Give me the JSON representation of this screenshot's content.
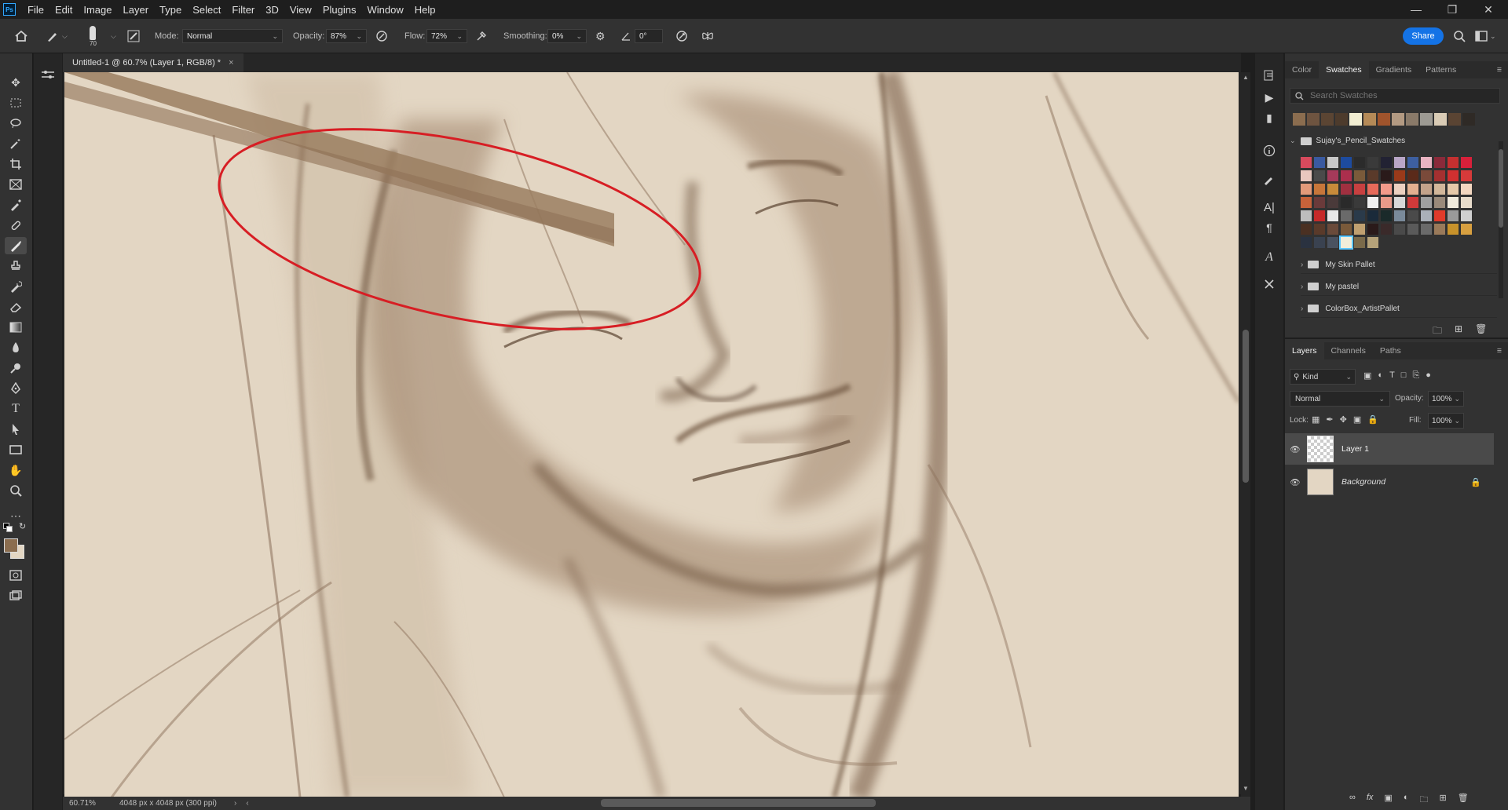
{
  "app": {
    "logo": "Ps",
    "menu": [
      "File",
      "Edit",
      "Image",
      "Layer",
      "Type",
      "Select",
      "Filter",
      "3D",
      "View",
      "Plugins",
      "Window",
      "Help"
    ]
  },
  "options": {
    "brush_size": "70",
    "mode_label": "Mode:",
    "mode_value": "Normal",
    "opacity_label": "Opacity:",
    "opacity_value": "87%",
    "flow_label": "Flow:",
    "flow_value": "72%",
    "smoothing_label": "Smoothing:",
    "smoothing_value": "0%",
    "angle_value": "0°",
    "share_label": "Share"
  },
  "document": {
    "tab_title": "Untitled-1 @ 60.7% (Layer 1, RGB/8) *",
    "zoom": "60.71%",
    "dimensions": "4048 px x 4048 px (300 ppi)"
  },
  "swatches_panel": {
    "tabs": [
      "Color",
      "Swatches",
      "Gradients",
      "Patterns"
    ],
    "active_tab": "Swatches",
    "search_placeholder": "Search Swatches",
    "recent": [
      "#8b6d4f",
      "#6e5440",
      "#5b4533",
      "#4d3b2c",
      "#f2eed2",
      "#b58a57",
      "#a0542c",
      "#b39a82",
      "#8a7a69",
      "#9d9a93",
      "#d9cbb5",
      "#5a4433",
      "#2f2a26"
    ],
    "open_group": "Sujay's_Pencil_Swatches",
    "grid": [
      [
        "#d84a5d",
        "#3a5aa0",
        "#c9c9c9",
        "#1d4b9f",
        "#2b2b2b",
        "#3a3a3a",
        "#222233",
        "#b9a6c7",
        "#3d5fa0",
        "#e9b3c1",
        "#8a2a3a",
        "#c53030",
        "#d8203a"
      ],
      [
        "#e9c8bf",
        "#4a4a4a",
        "#a53a5a",
        "#ab2f4d",
        "#7a5a3a",
        "#5a3a2a",
        "#2a1a1a",
        "#9a3a1a",
        "#5a2a1a",
        "#7a4a3a",
        "#a53030",
        "#d03030",
        "#d63a3a"
      ],
      [
        "#e39a7a",
        "#c7763a",
        "#c78a3a",
        "#a03040",
        "#c84040",
        "#e66a5a",
        "#f29a8a",
        "#ebd0c0",
        "#e3b090",
        "#c2a28a",
        "#d2b79a",
        "#e6c9a9",
        "#f3d7c0"
      ],
      [
        "#c7623a",
        "#6a3a3a",
        "#4a3a3a",
        "#2a2a2a",
        "#3a3a3a",
        "#f0f0f0",
        "#e89a8a",
        "#d8d8d8",
        "#d03a3a",
        "#a0a0a0",
        "#9a8a7a",
        "#f0eadc",
        "#e8dccb"
      ],
      [
        "#bdbdbd",
        "#c62a2a",
        "#e9e9e9",
        "#6a6a6a",
        "#2a3a4a",
        "#1a2a3a",
        "#1a2a2a",
        "#7a8a9a",
        "#4a4a4a",
        "#aab0b9",
        "#e03a2a",
        "#9a9a9a",
        "#d0d0d0"
      ],
      [
        "#4a3022",
        "#5a3a2a",
        "#6a4a3a",
        "#7a5a3a",
        "#c0a070",
        "#2a1a1a",
        "#3a2a2a",
        "#4a4a4a",
        "#5a5a5a",
        "#6a6a6a",
        "#9a7a5a",
        "#c8922a",
        "#d8a040"
      ],
      [
        "#2a3240",
        "#3a4250",
        "#4a5260",
        "#f2eeda",
        "#7a6a4a",
        "#b6a37a"
      ]
    ],
    "folders": [
      "My Skin Pallet",
      "My pastel",
      "ColorBox_ArtistPallet"
    ]
  },
  "layers_panel": {
    "tabs": [
      "Layers",
      "Channels",
      "Paths"
    ],
    "active_tab": "Layers",
    "filter_kind": "Kind",
    "blend_mode": "Normal",
    "opacity_label": "Opacity:",
    "opacity_value": "100%",
    "lock_label": "Lock:",
    "fill_label": "Fill:",
    "fill_value": "100%",
    "layers": [
      {
        "name": "Layer 1",
        "selected": true,
        "visible": true,
        "locked": false
      },
      {
        "name": "Background",
        "selected": false,
        "visible": true,
        "locked": true
      }
    ]
  },
  "colors": {
    "foreground": "#8b6d4f",
    "background": "#e3d6c3",
    "accent": "#1473e6",
    "annotation": "#d71e24"
  }
}
